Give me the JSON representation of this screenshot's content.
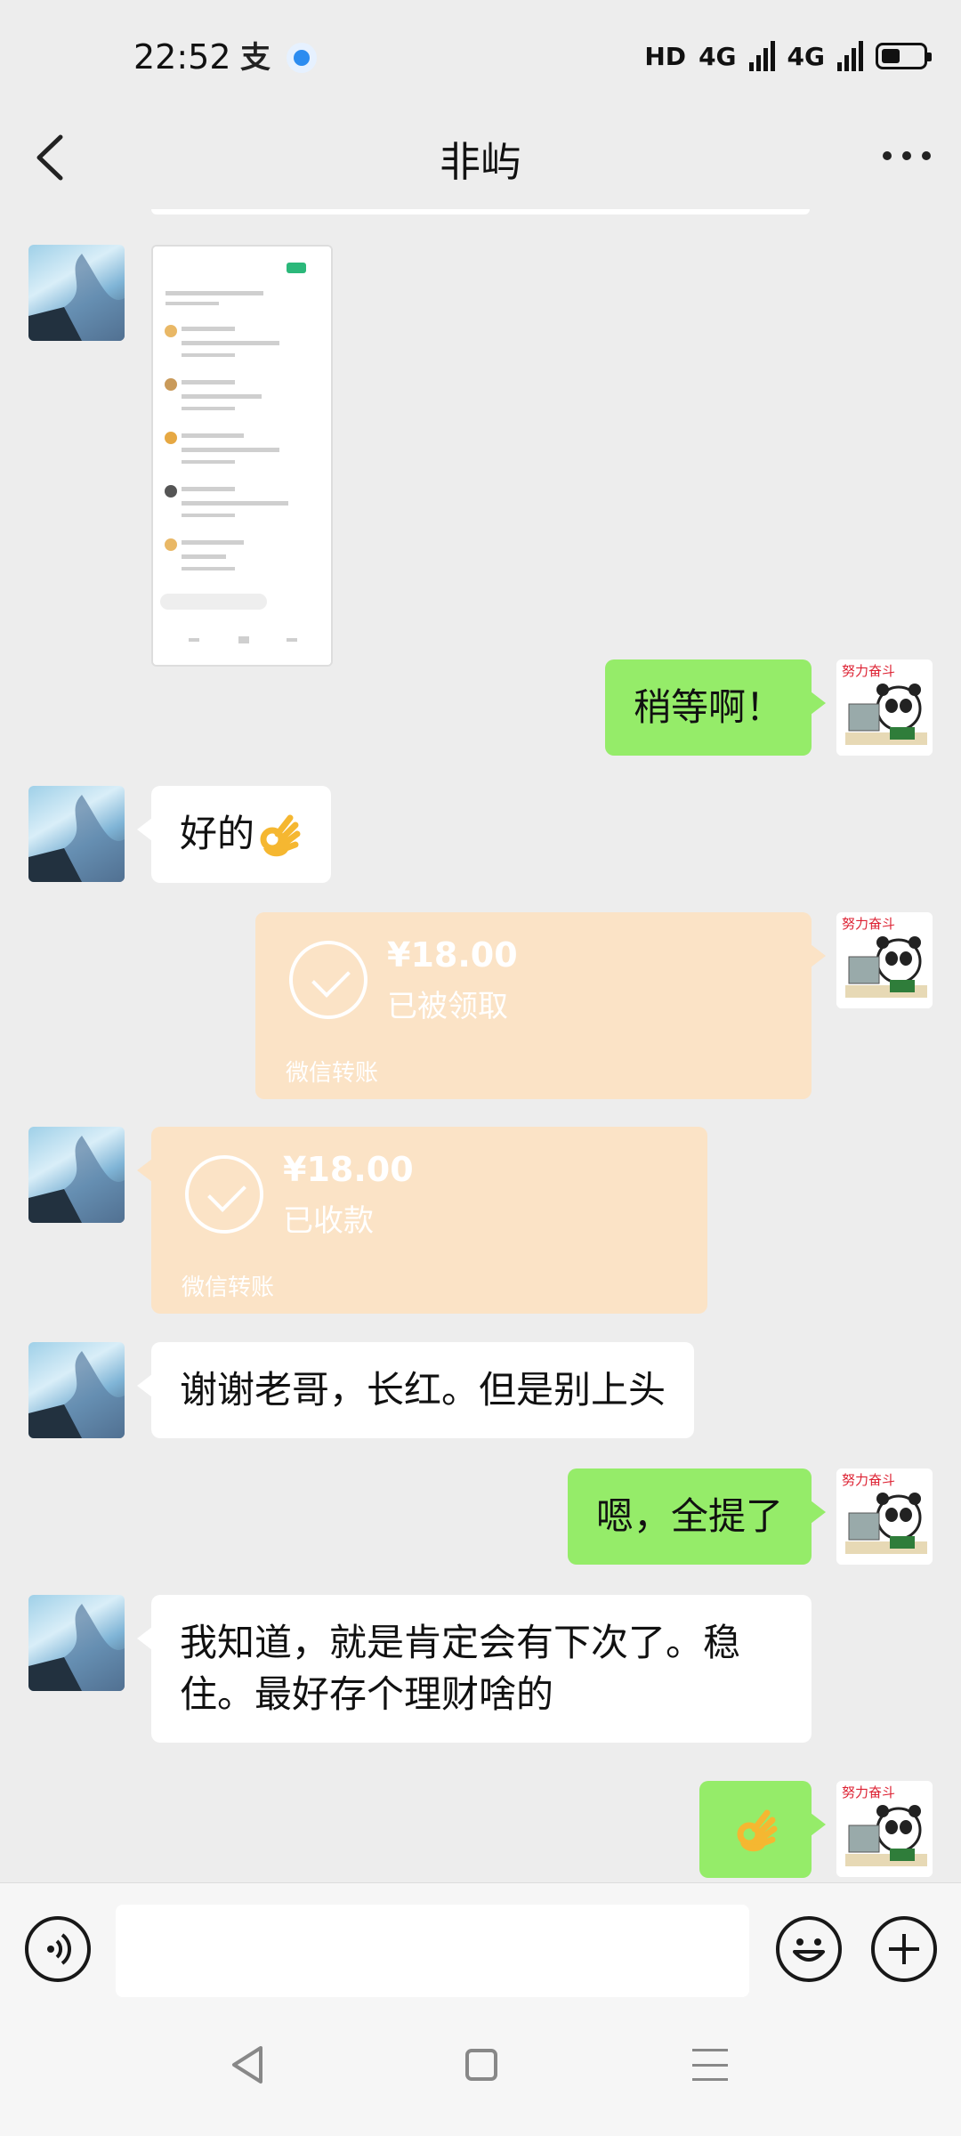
{
  "status_bar": {
    "time": "22:52",
    "hd_label": "HD",
    "network_1": "4G",
    "network_2": "4G",
    "icons": [
      "alipay-icon",
      "circle-app-icon",
      "signal-icon",
      "battery-icon"
    ]
  },
  "nav": {
    "title": "非屿",
    "icons": [
      "back-icon",
      "more-icon"
    ]
  },
  "messages": [
    {
      "side": "left",
      "type": "image"
    },
    {
      "side": "right",
      "type": "text",
      "text": "稍等啊！"
    },
    {
      "side": "left",
      "type": "text",
      "text": "好的",
      "emoji": "ok-hand-emoji"
    },
    {
      "side": "right",
      "type": "transfer",
      "amount": "¥18.00",
      "status": "已被领取",
      "label": "微信转账"
    },
    {
      "side": "left",
      "type": "transfer",
      "amount": "¥18.00",
      "status": "已收款",
      "label": "微信转账"
    },
    {
      "side": "left",
      "type": "text",
      "text": "谢谢老哥，长红。但是别上头"
    },
    {
      "side": "right",
      "type": "text",
      "text": "嗯，全提了"
    },
    {
      "side": "left",
      "type": "text",
      "text": "我知道，就是肯定会有下次了。稳住。最好存个理财啥的"
    },
    {
      "side": "right",
      "type": "emoji",
      "emoji": "ok-hand-emoji"
    }
  ],
  "input_bar": {
    "value": "",
    "icons": [
      "voice-icon",
      "emoji-icon",
      "plus-icon"
    ]
  },
  "colors": {
    "background": "#ededed",
    "sent_bubble": "#95ec69",
    "received_bubble": "#ffffff",
    "transfer_bubble": "#fbe3c6"
  }
}
